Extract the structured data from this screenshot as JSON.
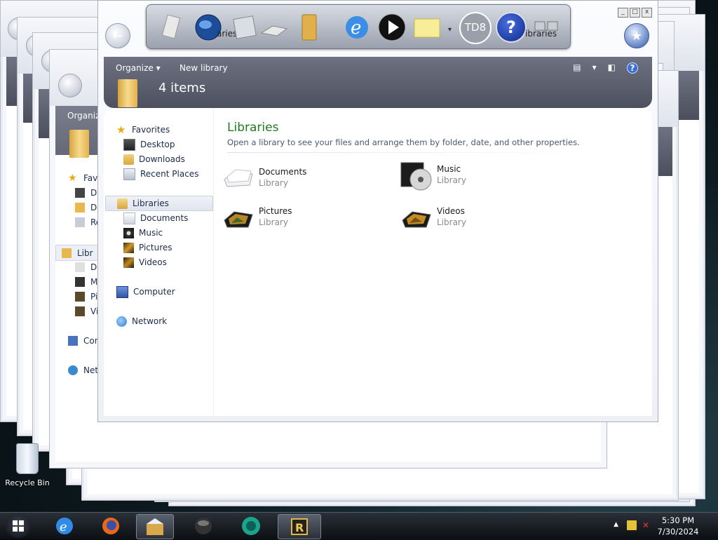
{
  "window": {
    "organize_label": "Organize",
    "new_library_label": "New library",
    "item_count": "4 items"
  },
  "nav": {
    "favorites": "Favorites",
    "desktop": "Desktop",
    "downloads": "Downloads",
    "recent_places": "Recent Places",
    "libraries": "Libraries",
    "documents": "Documents",
    "music": "Music",
    "pictures": "Pictures",
    "videos": "Videos",
    "computer": "Computer",
    "network": "Network"
  },
  "main": {
    "title": "Libraries",
    "description": "Open a library to see your files and arrange them by folder, date, and other properties.",
    "libraries": [
      {
        "name": "Documents",
        "type": "Library"
      },
      {
        "name": "Music",
        "type": "Library"
      },
      {
        "name": "Pictures",
        "type": "Library"
      },
      {
        "name": "Videos",
        "type": "Library"
      }
    ]
  },
  "back_window": {
    "organize_partial": "Organiz",
    "nav_partial": [
      "Favo",
      "De",
      "Do",
      "Re",
      "Libr",
      "De",
      "M",
      "Pi",
      "Vi",
      "Con",
      "Net"
    ]
  },
  "dock": {
    "td8_label": "TD8",
    "overlay_text_left": "aries",
    "overlay_text_right": "ibraries"
  },
  "desktop": {
    "recycle_bin": "Recycle Bin"
  },
  "taskbar": {
    "time": "5:30 PM",
    "date": "7/30/2024"
  },
  "colors": {
    "accent_title_green": "#1e7b1e",
    "command_bar": "#5a5d6b",
    "taskbar": "#13171c"
  }
}
